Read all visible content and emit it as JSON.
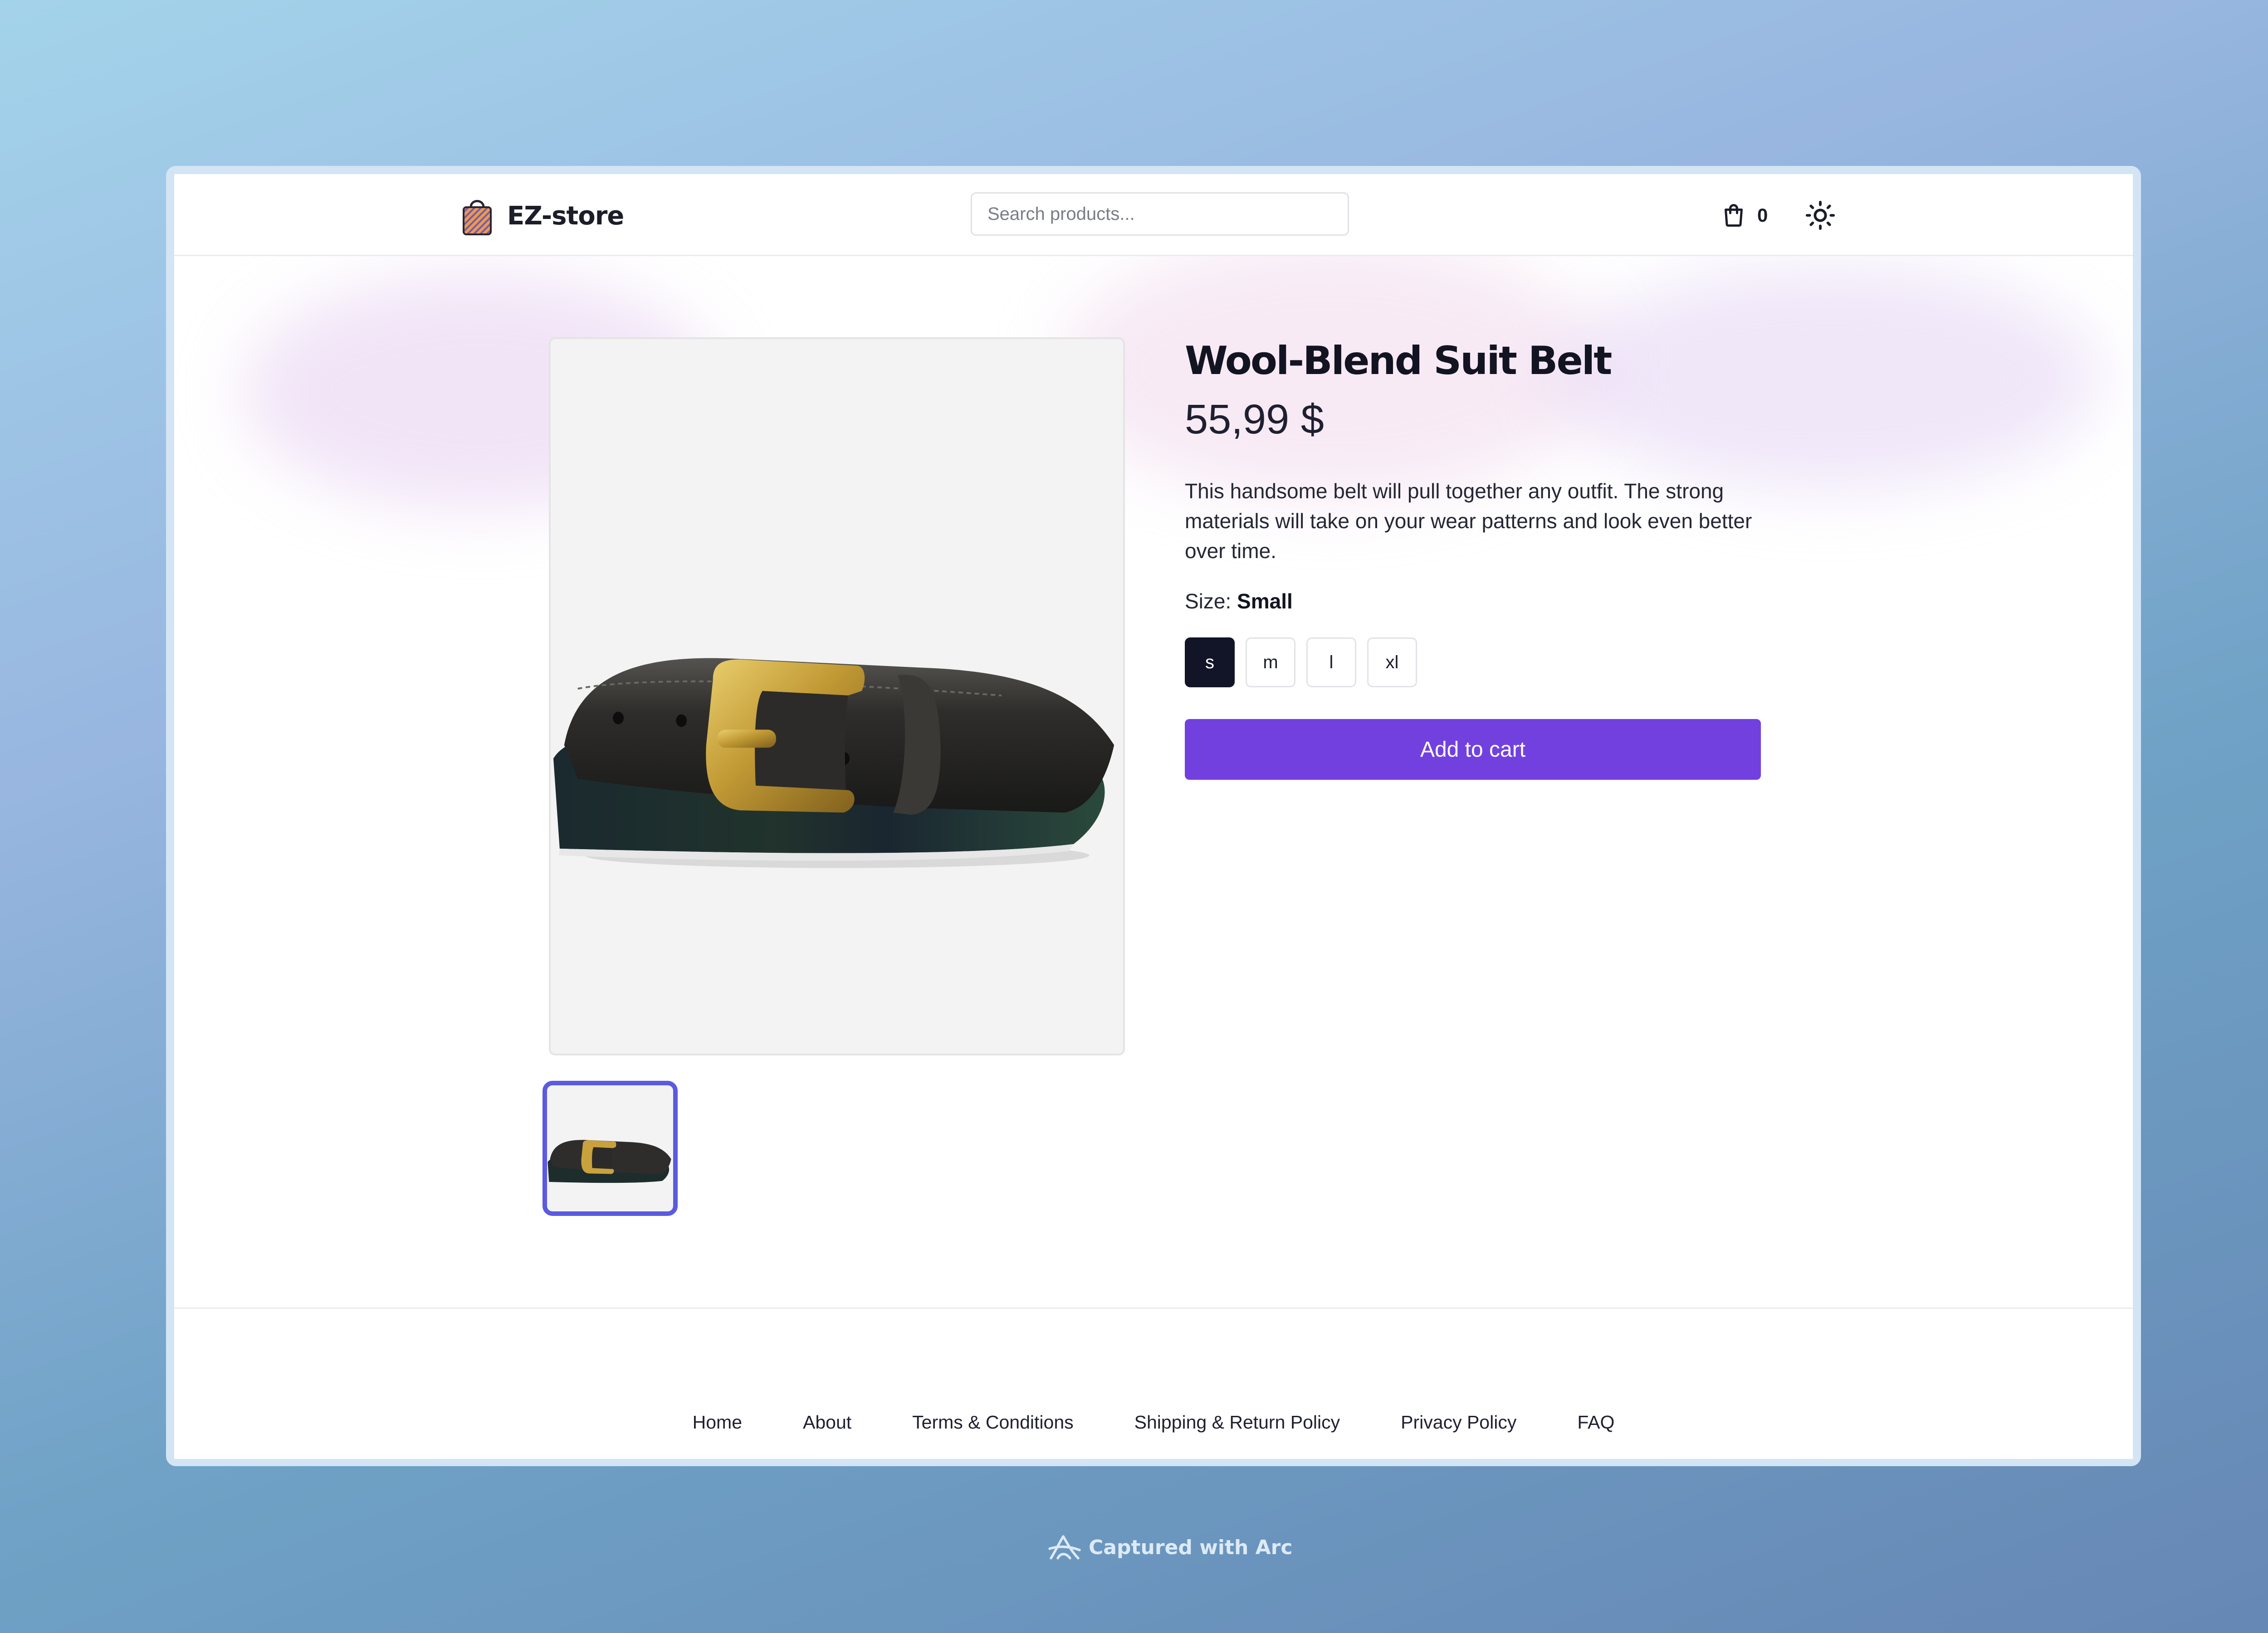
{
  "app": {
    "logo_text": "EZ-store",
    "logo_icon": "shopping-bag-icon"
  },
  "header": {
    "search_placeholder": "Search products...",
    "cart_icon": "shopping-bag-outline-icon",
    "cart_count": "0",
    "theme_icon": "sun-icon"
  },
  "product": {
    "title": "Wool-Blend Suit Belt",
    "price": "55,99 $",
    "description": "This handsome belt will pull together any outfit. The strong materials will take on your wear patterns and look even better over time.",
    "size_label": "Size:",
    "selected_size": "Small",
    "sizes": [
      "s",
      "m",
      "l",
      "xl"
    ],
    "add_to_cart_label": "Add to cart"
  },
  "footer": {
    "links": [
      "Home",
      "About",
      "Terms & Conditions",
      "Shipping & Return Policy",
      "Privacy Policy",
      "FAQ"
    ]
  },
  "capture": {
    "text": "Captured with Arc"
  },
  "colors": {
    "accent": "#7340e0",
    "thumb_border": "#5b5ae0",
    "selected_size_bg": "#121527"
  }
}
